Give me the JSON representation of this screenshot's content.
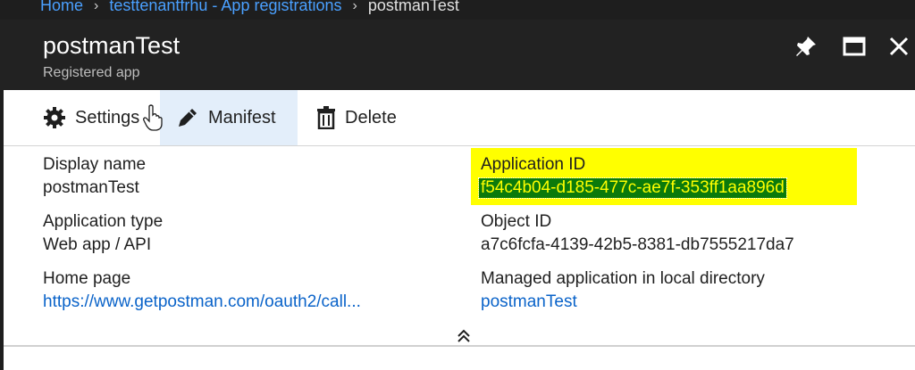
{
  "breadcrumb": {
    "items": [
      "Home",
      "testtenantfrhu - App registrations"
    ],
    "current": "postmanTest"
  },
  "header": {
    "title": "postmanTest",
    "subtitle": "Registered app"
  },
  "toolbar": {
    "settings_label": "Settings",
    "manifest_label": "Manifest",
    "delete_label": "Delete"
  },
  "properties": {
    "display_name": {
      "label": "Display name",
      "value": "postmanTest"
    },
    "application_type": {
      "label": "Application type",
      "value": "Web app / API"
    },
    "home_page": {
      "label": "Home page",
      "value": "https://www.getpostman.com/oauth2/call..."
    },
    "application_id": {
      "label": "Application ID",
      "value": "f54c4b04-d185-477c-ae7f-353ff1aa896d"
    },
    "object_id": {
      "label": "Object ID",
      "value": "a7c6fcfa-4139-42b5-8381-db7555217da7"
    },
    "managed_app": {
      "label": "Managed application in local directory",
      "value": "postmanTest"
    }
  },
  "icons": {
    "settings": "gear-icon",
    "manifest": "pencil-icon",
    "delete": "trash-icon",
    "pin": "pin-icon",
    "maximize": "maximize-icon",
    "close": "close-icon",
    "collapse": "double-chevron-up-icon"
  },
  "colors": {
    "highlight": "#ffff00",
    "selection": "#0b7a0b",
    "link": "#0a63c9",
    "header_bg": "#222222"
  }
}
